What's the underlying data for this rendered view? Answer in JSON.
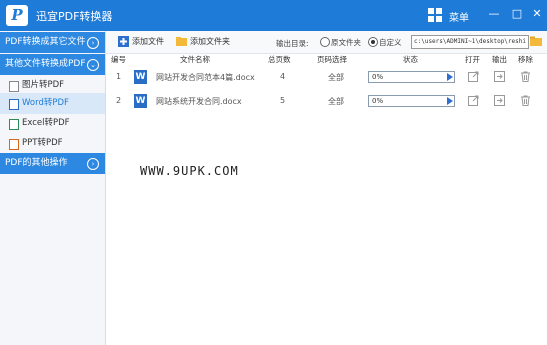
{
  "app": {
    "title": "迅宜PDF转换器",
    "menu": "菜单",
    "logo_letter": "P"
  },
  "sidebar": {
    "section1": "PDF转换成其它文件",
    "section2": "其他文件转换成PDF",
    "items": [
      "图片转PDF",
      "Word转PDF",
      "Excel转PDF",
      "PPT转PDF"
    ],
    "section3": "PDF的其他操作"
  },
  "toolbar": {
    "add_file": "添加文件",
    "add_folder": "添加文件夹",
    "output_label": "输出目录:",
    "option_original": "原文件夹",
    "option_custom": "自定义",
    "path": "c:\\users\\ADMINI~1\\desktop\\reshi"
  },
  "table": {
    "headers": [
      "编号",
      "文件名称",
      "总页数",
      "页码选择",
      "状态",
      "打开",
      "输出",
      "移除"
    ],
    "rows": [
      {
        "num": "1",
        "name": "网站开发合同范本4篇.docx",
        "pages": "4",
        "range": "全部",
        "progress": "0%"
      },
      {
        "num": "2",
        "name": "网站系统开发合同.docx",
        "pages": "5",
        "range": "全部",
        "progress": "0%"
      }
    ]
  },
  "watermark": "WWW.9UPK.COM",
  "colors": {
    "accent": "#1f7bd8",
    "section": "#2d88e1",
    "active_bg": "#d8e8f8"
  }
}
